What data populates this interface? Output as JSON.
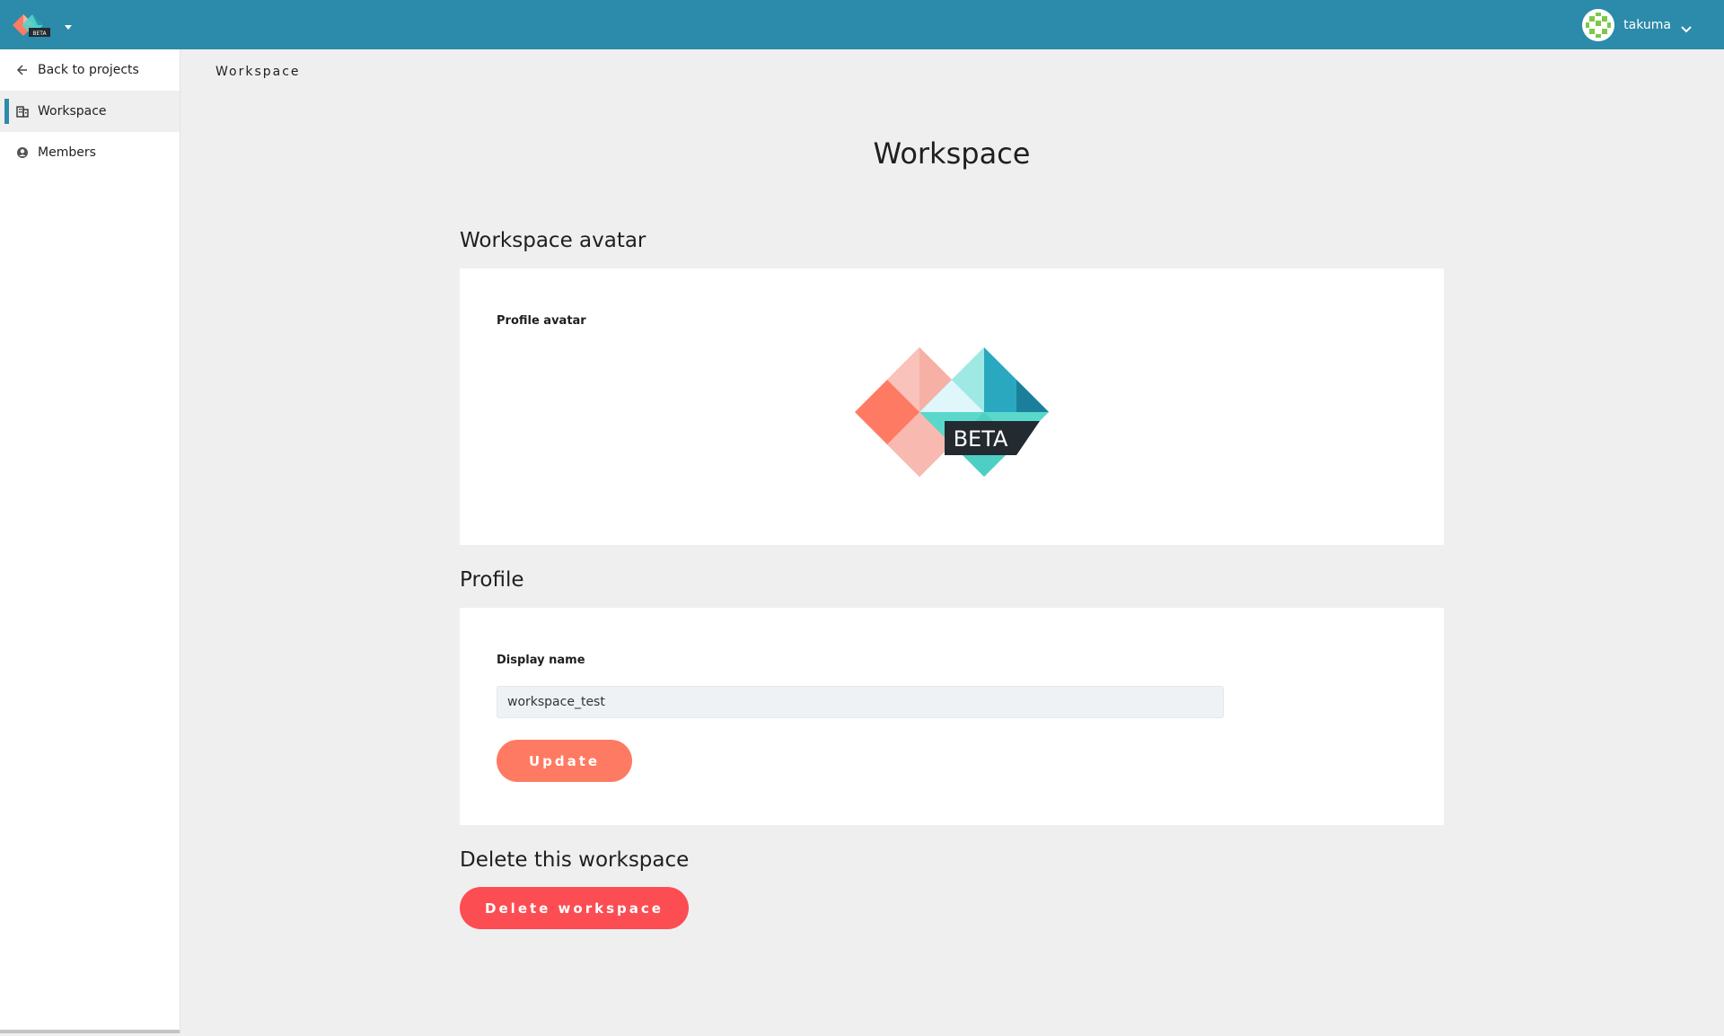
{
  "header": {
    "logo_icon": "reearth-logo-icon",
    "logo_badge": "BETA",
    "user_name": "takuma",
    "colors": {
      "bar": "#2c8aaa"
    }
  },
  "sidebar": {
    "items": [
      {
        "label": "Back to projects",
        "icon": "arrow-left-icon",
        "active": false
      },
      {
        "label": "Workspace",
        "icon": "building-icon",
        "active": true
      },
      {
        "label": "Members",
        "icon": "user-circle-icon",
        "active": false
      }
    ]
  },
  "breadcrumb": "Workspace",
  "page_title": "Workspace",
  "avatar_section": {
    "title": "Workspace avatar",
    "label": "Profile avatar",
    "avatar_badge": "BETA"
  },
  "profile_section": {
    "title": "Profile",
    "display_name_label": "Display name",
    "display_name_value": "workspace_test",
    "update_label": "Update"
  },
  "delete_section": {
    "title": "Delete this workspace",
    "delete_label": "Delete workspace"
  },
  "colors": {
    "accent": "#2c8aaa",
    "update_button": "#ff7a62",
    "delete_button": "#fc4d52"
  }
}
